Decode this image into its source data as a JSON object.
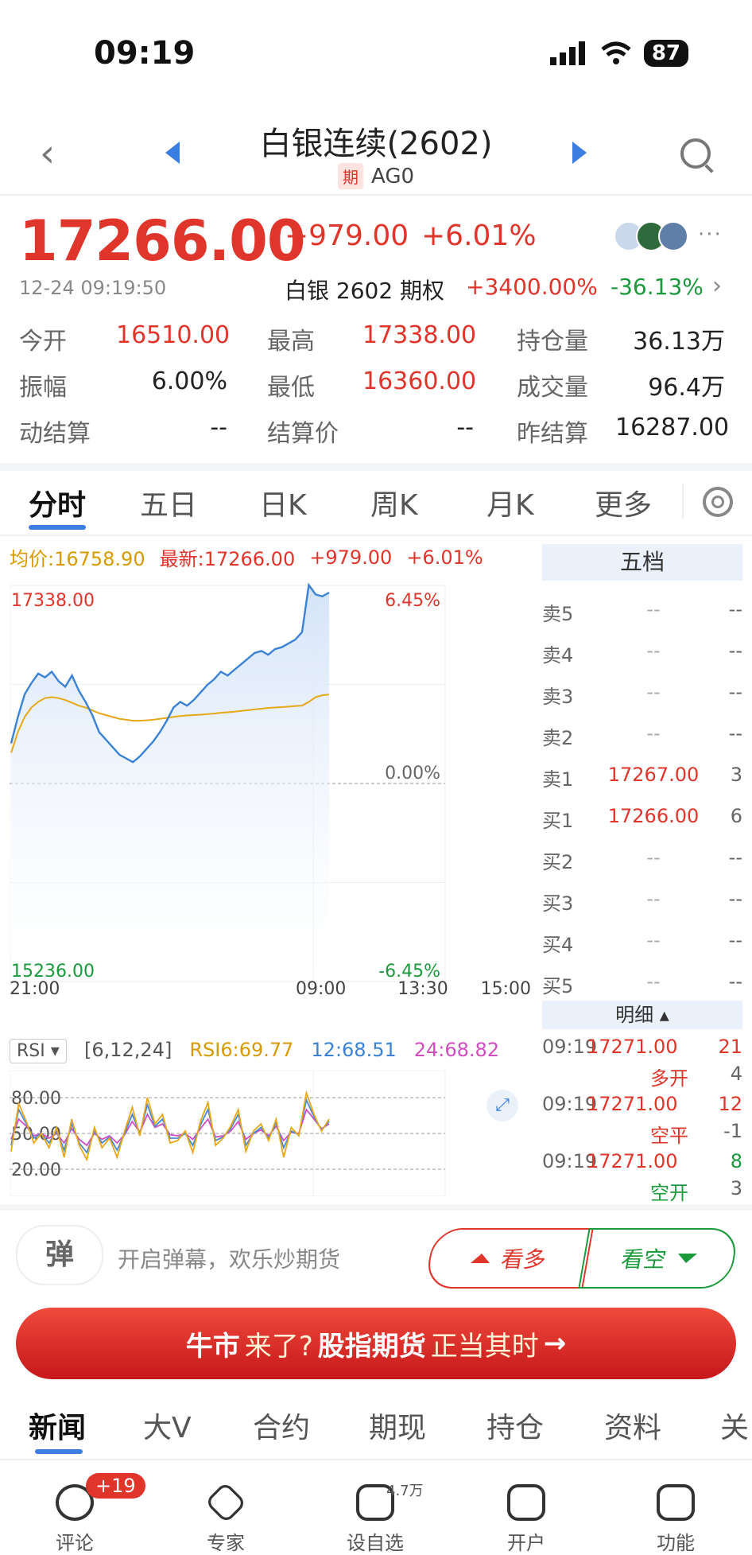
{
  "status_bar": {
    "time": "09:19",
    "battery": "87"
  },
  "header": {
    "title": "白银连续(2602)",
    "tag": "期",
    "code": "AG0"
  },
  "quote": {
    "price": "17266.00",
    "change": "+979.00",
    "change_pct": "+6.01%",
    "timestamp": "12-24 09:19:50",
    "option_name": "白银 2602 期权",
    "option_change": "+3400.00%",
    "option_pct": "-36.13%"
  },
  "stats": [
    [
      {
        "label": "今开",
        "value": "16510.00",
        "color": "red"
      },
      {
        "label": "最高",
        "value": "17338.00",
        "color": "red"
      },
      {
        "label": "持仓量",
        "value": "36.13万",
        "color": "black"
      }
    ],
    [
      {
        "label": "振幅",
        "value": "6.00%",
        "color": "black"
      },
      {
        "label": "最低",
        "value": "16360.00",
        "color": "red"
      },
      {
        "label": "成交量",
        "value": "96.4万",
        "color": "black"
      }
    ],
    [
      {
        "label": "动结算",
        "value": "--",
        "color": "black"
      },
      {
        "label": "结算价",
        "value": "--",
        "color": "black"
      },
      {
        "label": "昨结算",
        "value": "16287.00",
        "color": "black"
      }
    ]
  ],
  "period_tabs": [
    "分时",
    "五日",
    "日K",
    "周K",
    "月K",
    "更多"
  ],
  "chart_head": {
    "avg": "均价:16758.90",
    "latest": "最新:17266.00",
    "chg": "+979.00",
    "pct": "+6.01%"
  },
  "chart_data": {
    "type": "line",
    "y_left_labels": [
      "17338.00",
      "15236.00"
    ],
    "y_right_labels": [
      "6.45%",
      "0.00%",
      "-6.45%"
    ],
    "x_labels": [
      "21:00",
      "09:00",
      "13:30",
      "15:00"
    ],
    "ylim": [
      15236,
      17338
    ],
    "baseline": 16287,
    "series": [
      {
        "color": "#3b82d6",
        "values": [
          16500,
          16640,
          16760,
          16820,
          16870,
          16850,
          16880,
          16830,
          16800,
          16860,
          16780,
          16720,
          16650,
          16560,
          16520,
          16480,
          16440,
          16420,
          16400,
          16430,
          16470,
          16510,
          16560,
          16620,
          16690,
          16720,
          16700,
          16730,
          16770,
          16810,
          16840,
          16880,
          16860,
          16890,
          16920,
          16950,
          16980,
          16990,
          16970,
          17000,
          17010,
          17030,
          17050,
          17090,
          17340,
          17290,
          17280,
          17300
        ]
      },
      {
        "color": "#e6a817",
        "values": [
          16450,
          16560,
          16640,
          16690,
          16720,
          16740,
          16745,
          16740,
          16730,
          16715,
          16700,
          16690,
          16675,
          16660,
          16650,
          16640,
          16630,
          16625,
          16620,
          16620,
          16622,
          16625,
          16630,
          16635,
          16640,
          16645,
          16648,
          16650,
          16652,
          16655,
          16658,
          16662,
          16665,
          16668,
          16672,
          16676,
          16680,
          16684,
          16688,
          16690,
          16692,
          16695,
          16698,
          16700,
          16720,
          16745,
          16755,
          16759
        ]
      }
    ]
  },
  "rsi": {
    "dropdown": "RSI",
    "params": "[6,12,24]",
    "rsi6": "RSI6:69.77",
    "rsi12": "12:68.51",
    "rsi24": "24:68.82",
    "y_labels": [
      "80.00",
      "50.00",
      "20.00"
    ],
    "ylim": [
      0,
      100
    ],
    "series": [
      {
        "name": "RSI6",
        "color": "#e6a817",
        "values": [
          35,
          75,
          60,
          42,
          50,
          38,
          55,
          30,
          62,
          40,
          28,
          55,
          38,
          46,
          30,
          52,
          72,
          48,
          80,
          58,
          66,
          42,
          44,
          52,
          34,
          60,
          76,
          40,
          46,
          56,
          70,
          35,
          52,
          58,
          44,
          62,
          30,
          55,
          48,
          84,
          66,
          52,
          62
        ]
      },
      {
        "name": "RSI12",
        "color": "#4a8ad4",
        "values": [
          40,
          70,
          58,
          46,
          50,
          42,
          52,
          36,
          58,
          42,
          34,
          52,
          42,
          47,
          36,
          50,
          66,
          50,
          74,
          56,
          62,
          46,
          46,
          50,
          40,
          57,
          70,
          44,
          47,
          54,
          66,
          40,
          50,
          55,
          46,
          59,
          38,
          52,
          49,
          78,
          64,
          53,
          60
        ]
      },
      {
        "name": "RSI24",
        "color": "#d24ec0",
        "values": [
          45,
          62,
          56,
          48,
          50,
          46,
          50,
          42,
          54,
          45,
          40,
          50,
          45,
          48,
          42,
          49,
          60,
          51,
          66,
          55,
          58,
          49,
          48,
          50,
          45,
          54,
          62,
          47,
          48,
          52,
          60,
          45,
          50,
          53,
          48,
          56,
          44,
          51,
          50,
          70,
          62,
          54,
          58
        ]
      }
    ]
  },
  "wudang": {
    "title": "五档",
    "rows": [
      {
        "label": "卖5",
        "price": "--",
        "vol": "--"
      },
      {
        "label": "卖4",
        "price": "--",
        "vol": "--"
      },
      {
        "label": "卖3",
        "price": "--",
        "vol": "--"
      },
      {
        "label": "卖2",
        "price": "--",
        "vol": "--"
      },
      {
        "label": "卖1",
        "price": "17267.00",
        "vol": "3"
      },
      {
        "label": "买1",
        "price": "17266.00",
        "vol": "6"
      },
      {
        "label": "买2",
        "price": "--",
        "vol": "--"
      },
      {
        "label": "买3",
        "price": "--",
        "vol": "--"
      },
      {
        "label": "买4",
        "price": "--",
        "vol": "--"
      },
      {
        "label": "买5",
        "price": "--",
        "vol": "--"
      }
    ]
  },
  "detail": {
    "title": "明细",
    "rows": [
      {
        "time": "09:19",
        "price": "17271.00",
        "vol": "21",
        "vol_color": "red",
        "tag": "多开",
        "tag_color": "red",
        "vol2": "4"
      },
      {
        "time": "09:19",
        "price": "17271.00",
        "vol": "12",
        "vol_color": "red",
        "tag": "空平",
        "tag_color": "red",
        "vol2": "-1"
      },
      {
        "time": "09:19",
        "price": "17271.00",
        "vol": "8",
        "vol_color": "green",
        "tag": "空开",
        "tag_color": "green",
        "vol2": "3"
      }
    ]
  },
  "action_bar": {
    "danmu_icon": "弹",
    "danmu_text": "开启弹幕，欢乐炒期货",
    "bull": "看多",
    "bear": "看空"
  },
  "banner": {
    "part1": "牛市",
    "part2": "来了?",
    "part3": "股指期货",
    "part4": "正当其时",
    "arrow": "→"
  },
  "news_tabs": [
    "新闻",
    "大V",
    "合约",
    "期现",
    "持仓",
    "资料",
    "关"
  ],
  "bottom_nav": [
    {
      "label": "评论",
      "icon": "comment-icon"
    },
    {
      "label": "专家",
      "icon": "expert-icon"
    },
    {
      "label": "设自选",
      "icon": "watchlist-icon"
    },
    {
      "label": "开户",
      "icon": "open-account-icon"
    },
    {
      "label": "功能",
      "icon": "menu-icon"
    }
  ],
  "badges": {
    "comment": "+19",
    "watch_count": "4.7万"
  },
  "colors": {
    "up": "#e0352b",
    "down": "#1a9a3c",
    "accent": "#3b7de0",
    "avg": "#d79a00"
  }
}
